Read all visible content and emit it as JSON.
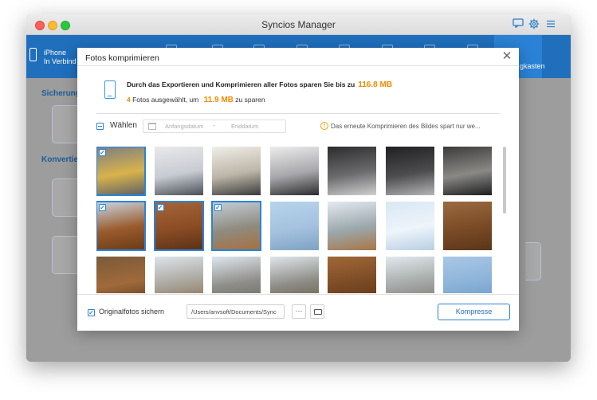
{
  "window": {
    "title": "Syncios Manager"
  },
  "titlebar_icons": [
    "chat-icon",
    "gear-icon",
    "menu-icon"
  ],
  "device": {
    "name": "iPhone",
    "status": "In Verbind"
  },
  "nav": {
    "toolbox_label": "gkasten"
  },
  "background_sections": {
    "backup_title": "Sicherung",
    "convert_title": "Konvertier"
  },
  "dialog": {
    "title": "Fotos komprimieren",
    "info_line1_text": "Durch das Exportieren und Komprimieren aller Fotos sparen Sie bis zu",
    "info_line1_value": "116.8 MB",
    "info_count": "4",
    "info_line2_text": "Fotos ausgewählt, um",
    "info_line2_value": "11.9 MB",
    "info_line2_suffix": "zu sparen",
    "select_label": "Wählen",
    "date_start_placeholder": "Anfangsdatum",
    "date_separator": "-",
    "date_end_placeholder": "Enddatum",
    "warning_text": "Das erneute Komprimieren des Bildes spart nur we...",
    "backup_label": "Originalfotos sichern",
    "backup_checked": true,
    "path_value": "/Users/anvsoft/Documents/Sync",
    "more_label": "···",
    "compress_button": "Kompresse"
  },
  "photos": [
    {
      "selected": true,
      "colors": [
        "#7b7f86",
        "#d9b24a",
        "#5c6068"
      ]
    },
    {
      "selected": false,
      "colors": [
        "#e9e9ea",
        "#c8cbd2",
        "#4a4f58"
      ]
    },
    {
      "selected": false,
      "colors": [
        "#f0eee8",
        "#bdb6a8",
        "#3a3a3c"
      ]
    },
    {
      "selected": false,
      "colors": [
        "#ececec",
        "#a8a8ac",
        "#2c2c2e"
      ]
    },
    {
      "selected": false,
      "colors": [
        "#2c2c2e",
        "#6b6b6e",
        "#d0d0d0"
      ]
    },
    {
      "selected": false,
      "colors": [
        "#202023",
        "#4d4d50",
        "#b5b5b8"
      ]
    },
    {
      "selected": false,
      "colors": [
        "#3c3b3a",
        "#8a8986",
        "#1e1e1f"
      ]
    },
    {
      "selected": true,
      "colors": [
        "#c9d7e6",
        "#9a5b2c",
        "#6a3a18"
      ]
    },
    {
      "selected": true,
      "colors": [
        "#a7663a",
        "#8a4c24",
        "#5a3016"
      ]
    },
    {
      "selected": true,
      "colors": [
        "#c5cfd9",
        "#8f8b7f",
        "#a86f3f"
      ]
    },
    {
      "selected": false,
      "colors": [
        "#b8d4ec",
        "#a4c2de",
        "#7ea2c4"
      ]
    },
    {
      "selected": false,
      "colors": [
        "#e4eaf0",
        "#9ba8ad",
        "#a87646"
      ]
    },
    {
      "selected": false,
      "colors": [
        "#d8e8f5",
        "#eef4fa",
        "#b8cfe4"
      ]
    },
    {
      "selected": false,
      "colors": [
        "#9a6a40",
        "#7a4a26",
        "#5a361a"
      ]
    },
    {
      "selected": false,
      "colors": [
        "#7a5a3a",
        "#a06a3a",
        "#5a3a20"
      ]
    },
    {
      "selected": false,
      "colors": [
        "#dde4ea",
        "#a8a49a",
        "#8a6a4a"
      ]
    },
    {
      "selected": false,
      "colors": [
        "#dee6ee",
        "#8e8d88",
        "#6a6a66"
      ]
    },
    {
      "selected": false,
      "colors": [
        "#dfe5ea",
        "#8c8b84",
        "#6a5a48"
      ]
    },
    {
      "selected": false,
      "colors": [
        "#a06838",
        "#7a4a24",
        "#5c3518"
      ]
    },
    {
      "selected": false,
      "colors": [
        "#e2e8ed",
        "#a4a8a6",
        "#7c7a72"
      ]
    },
    {
      "selected": false,
      "colors": [
        "#aac8e6",
        "#8ab2d8",
        "#6c98c4"
      ]
    }
  ]
}
